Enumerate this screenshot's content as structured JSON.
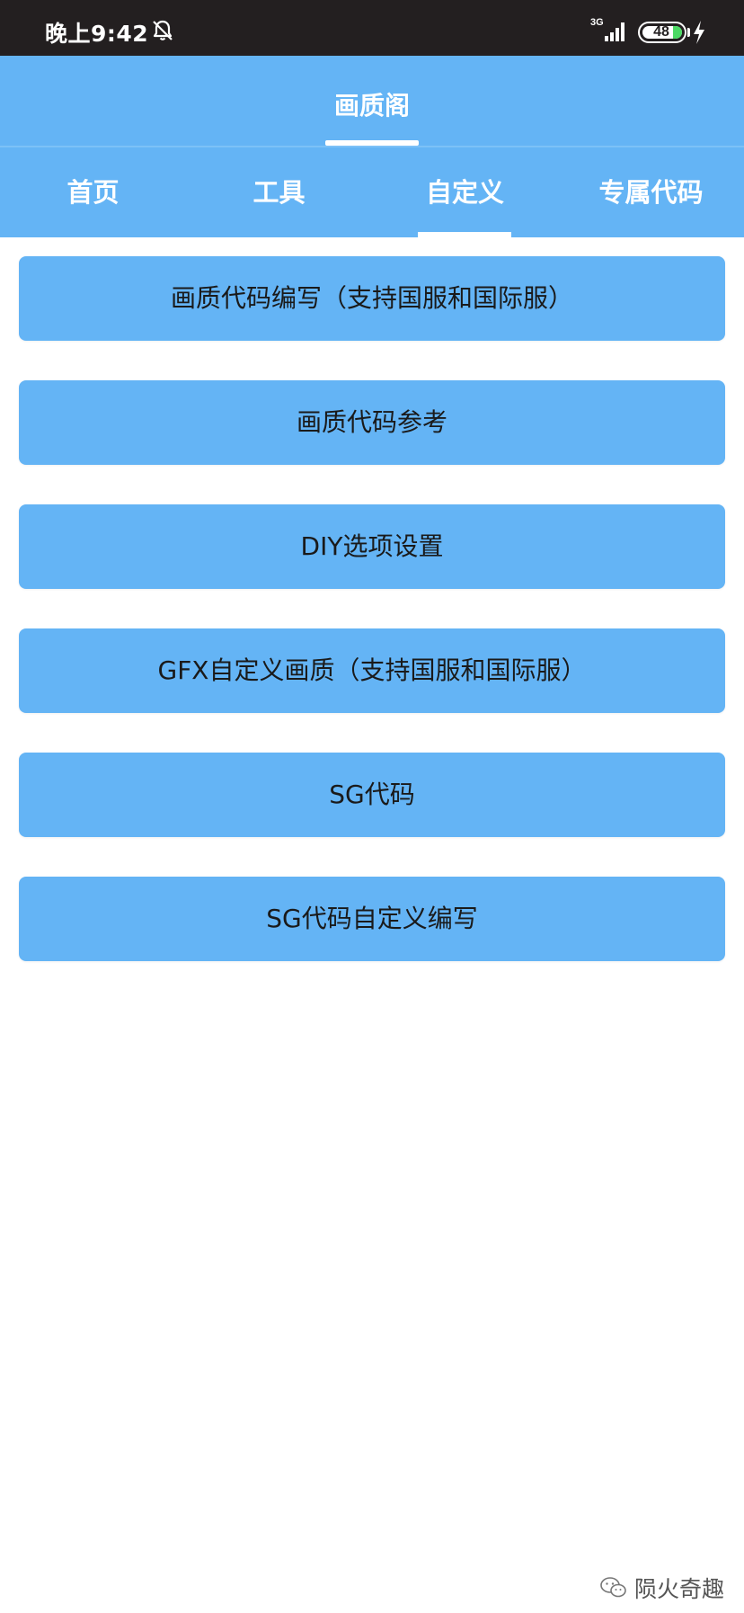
{
  "status_bar": {
    "time": "晚上9:42",
    "network": "3G",
    "battery": "48",
    "icons": [
      "bell-off-icon",
      "signal-icon",
      "battery-icon",
      "charging-bolt-icon"
    ]
  },
  "header": {
    "title": "画质阁"
  },
  "tabs": [
    {
      "label": "首页"
    },
    {
      "label": "工具"
    },
    {
      "label": "自定义"
    },
    {
      "label": "专属代码"
    }
  ],
  "active_tab": "自定义",
  "buttons": [
    {
      "label": "画质代码编写（支持国服和国际服）"
    },
    {
      "label": "画质代码参考"
    },
    {
      "label": "DIY选项设置"
    },
    {
      "label": "GFX自定义画质（支持国服和国际服）"
    },
    {
      "label": "SG代码"
    },
    {
      "label": "SG代码自定义编写"
    }
  ],
  "watermark": {
    "text": "陨火奇趣",
    "icon": "wechat-icon"
  },
  "colors": {
    "accent": "#64b4f5",
    "status_bar": "#231f20",
    "background": "#ffffff",
    "button_text": "#1a1a1a"
  }
}
